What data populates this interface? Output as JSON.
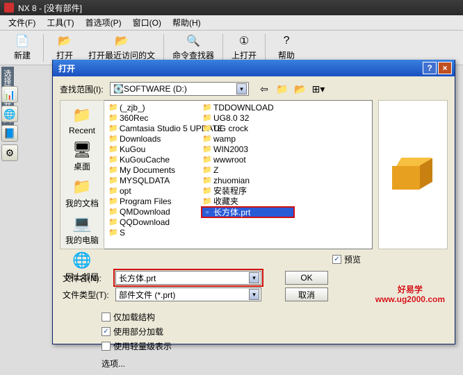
{
  "app": {
    "title": "NX 8 - [没有部件]"
  },
  "menubar": [
    "文件(F)",
    "工具(T)",
    "首选项(P)",
    "窗口(O)",
    "帮助(H)"
  ],
  "toolbar": {
    "new": "新建",
    "open": "打开",
    "recent": "打开最近访问的文",
    "finder": "命令查找器",
    "iopen": "上打开",
    "help": "帮助"
  },
  "sideLabel": "选择要打开的文",
  "dialog": {
    "title": "打开",
    "lookInLabel": "查找范围(I):",
    "lookInValue": "SOFTWARE (D:)",
    "places": {
      "recent": "Recent",
      "desktop": "桌面",
      "mydocs": "我的文档",
      "mycomp": "我的电脑",
      "network": "网上邻居"
    },
    "folders": [
      "(_zjb_)",
      "360Rec",
      "Camtasia Studio 5 UPDATE",
      "Downloads",
      "KuGou",
      "KuGouCache",
      "My Documents",
      "MYSQLDATA",
      "opt",
      "Program Files",
      "QMDownload",
      "QQDownload",
      "S",
      "TDDOWNLOAD",
      "UG8.0 32",
      "UG crock",
      "wamp",
      "WIN2003",
      "wwwroot",
      "Z",
      "zhuomian",
      "安装程序",
      "收藏夹"
    ],
    "selectedFile": "长方体.prt",
    "previewLabel": "预览",
    "fileNameLabel": "文件名(N):",
    "fileNameValue": "长方体.prt",
    "fileTypeLabel": "文件类型(T):",
    "fileTypeValue": "部件文件 (*.prt)",
    "ok": "OK",
    "cancel": "取消",
    "opt1": "仅加载结构",
    "opt2": "使用部分加载",
    "opt3": "使用轻量级表示",
    "optionsLink": "选项..."
  },
  "watermark": {
    "l1": "好易学",
    "l2": "www.ug2000.com"
  }
}
